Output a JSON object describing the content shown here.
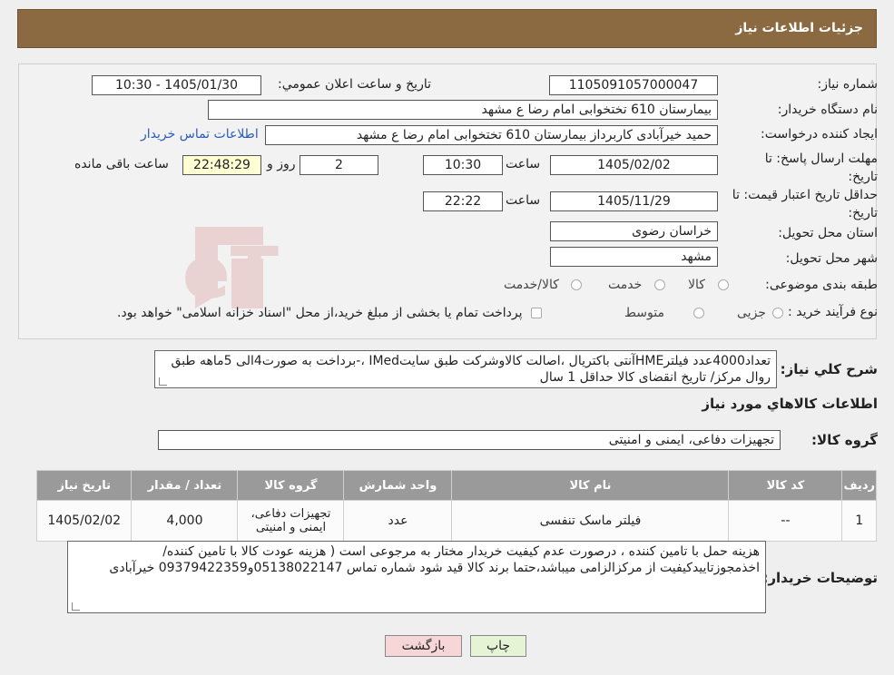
{
  "header": {
    "title": "جزئیات اطلاعات نیاز"
  },
  "fields": {
    "need_number_label": "شماره نیاز:",
    "need_number": "1105091057000047",
    "announce_label": "تاریخ و ساعت اعلان عمومي:",
    "announce_value": "1405/01/30 - 10:30",
    "buyer_org_label": "نام دستگاه خریدار:",
    "buyer_org": "بیمارستان 610 تختخوابی امام رضا ع  مشهد",
    "creator_label": "ایجاد کننده درخواست:",
    "creator": "حمید خیرآبادی کاربرداز بیمارستان 610 تختخوابی امام رضا ع  مشهد",
    "contact_link": "اطلاعات تماس خریدار",
    "deadline_label": "مهلت ارسال پاسخ: تا تاریخ:",
    "deadline_date": "1405/02/02",
    "time_label": "ساعت",
    "deadline_time": "10:30",
    "days_value": "2",
    "days_label": "روز و",
    "remaining_time": "22:48:29",
    "remaining_label": "ساعت باقی مانده",
    "validity_label": "حداقل تاریخ اعتبار قیمت: تا تاریخ:",
    "validity_date": "1405/11/29",
    "validity_time": "22:22",
    "province_label": "استان محل تحویل:",
    "province": "خراسان رضوی",
    "city_label": "شهر محل تحویل:",
    "city": "مشهد",
    "category_label": "طبقه بندی موضوعی:",
    "category_options": [
      "کالا",
      "خدمت",
      "کالا/خدمت"
    ],
    "process_label": "نوع فرآیند خرید :",
    "process_options": [
      "جزیی",
      "متوسط"
    ],
    "process_note": "پرداخت تمام یا بخشی از مبلغ خرید،از محل \"اسناد خزانه اسلامی\" خواهد بود."
  },
  "summary": {
    "label": "شرح کلي نياز:",
    "text": "تعداد4000عدد فیلترHMEآنتی باکتریال ،اصالت کالاوشرکت طبق سایتIMed ،-برداخت به صورت4الی 5ماهه طبق روال مرکز/ تاریخ انقضای کالا حداقل 1 سال"
  },
  "goods_section": {
    "title": "اطلاعات کالاهاي مورد نياز",
    "group_label": "گروه کالا:",
    "group_value": "تجهیزات دفاعی، ایمنی و امنیتی"
  },
  "table": {
    "headers": [
      "ردیف",
      "کد کالا",
      "نام کالا",
      "واحد شمارش",
      "گروه کالا",
      "تعداد / مقدار",
      "تاریخ نیاز"
    ],
    "rows": [
      [
        "1",
        "--",
        "فیلتر ماسک تنفسی",
        "عدد",
        "تجهیزات دفاعی، ایمنی و امنیتی",
        "4,000",
        "1405/02/02"
      ]
    ]
  },
  "buyer_notes": {
    "label": "توضیحات خریدار:",
    "text": "هزینه حمل با تامین کننده ، درصورت عدم کیفیت خریدار مختار به مرجوعی است ( هزینه عودت کالا با تامین کننده/ اخذمجوزتاییدکیفیت از مرکزالزامی میباشد،حتما برند کالا قید شود شماره تماس 05138022147و09379422359 خیرآبادی"
  },
  "buttons": {
    "print": "چاپ",
    "back": "بازگشت"
  },
  "watermark_text": "AriaTender.neT",
  "colors": {
    "header": "#8b6a42",
    "link": "#2c5bb8",
    "table_header": "#9a9a9a",
    "yellow": "#ffffd4",
    "back_button": "#f6d6d6",
    "print_button": "#e6f4d6"
  }
}
